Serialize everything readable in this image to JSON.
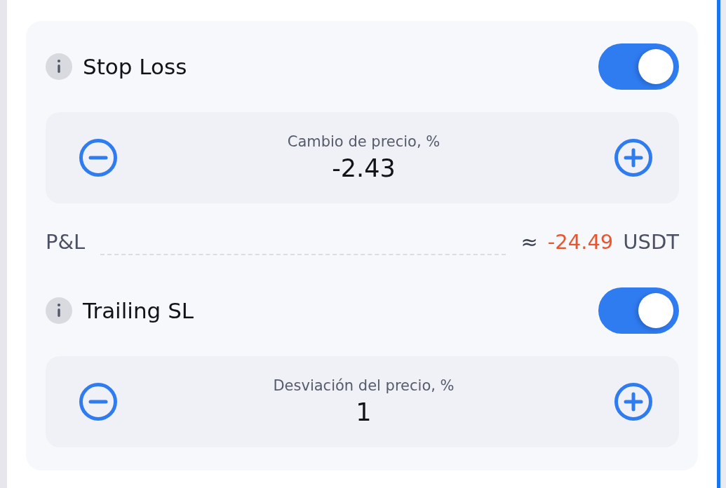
{
  "sections": [
    {
      "title": "Stop Loss",
      "on": true,
      "stepper": {
        "label": "Cambio de precio, %",
        "value": "-2.43"
      },
      "result": {
        "label": "P&L",
        "approx": "≈",
        "value": "-24.49",
        "unit": "USDT"
      }
    },
    {
      "title": "Trailing SL",
      "on": true,
      "stepper": {
        "label": "Desviación del precio, %",
        "value": "1"
      }
    }
  ]
}
